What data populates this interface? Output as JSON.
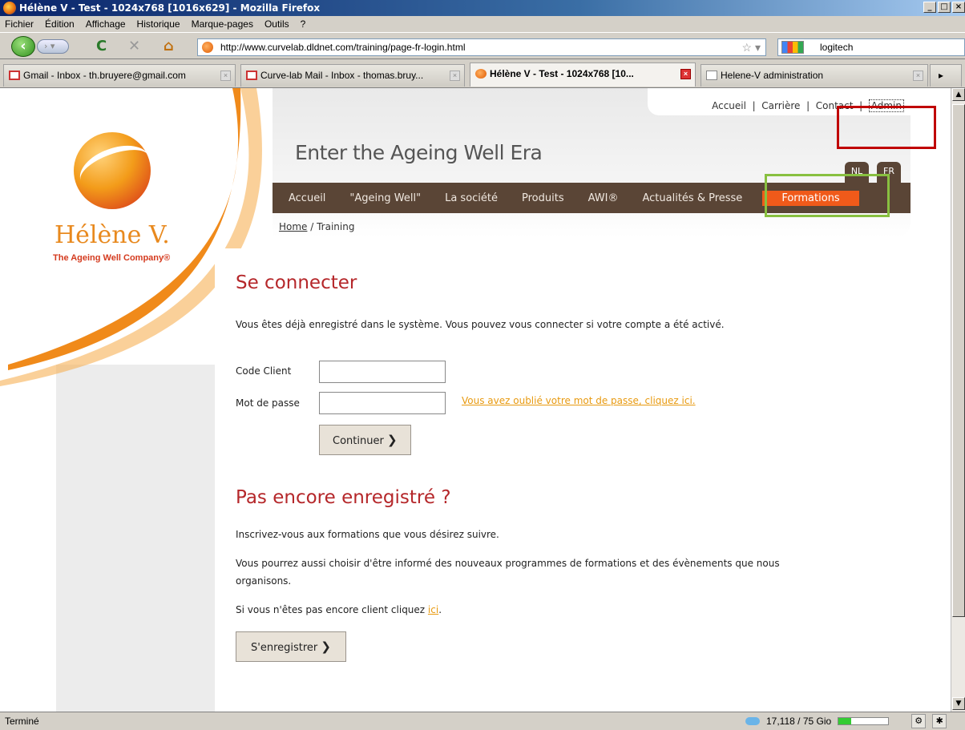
{
  "window": {
    "title": "Hélène V - Test - 1024x768 [1016x629] - Mozilla Firefox",
    "buttons": [
      "_",
      "□",
      "×"
    ]
  },
  "menubar": {
    "items": [
      "Fichier",
      "Édition",
      "Affichage",
      "Historique",
      "Marque-pages",
      "Outils",
      "?"
    ]
  },
  "navbar": {
    "url": "http://www.curvelab.dldnet.com/training/page-fr-login.html",
    "search_value": "logitech",
    "back_icon": "back-arrow-icon",
    "reload_icon": "C",
    "stop_icon": "✕",
    "home_icon": "⌂"
  },
  "tabs": [
    {
      "label": "Gmail - Inbox - th.bruyere@gmail.com",
      "active": false
    },
    {
      "label": "Curve-lab Mail - Inbox - thomas.bruy...",
      "active": false
    },
    {
      "label": "Hélène V - Test - 1024x768 [10...",
      "active": true
    },
    {
      "label": "Helene-V administration",
      "active": false
    }
  ],
  "site": {
    "brand": "Hélène V.",
    "tagline": "The Ageing Well Company®",
    "slogan": "Enter the Ageing Well Era",
    "top_links": [
      "Accueil",
      "Carrière",
      "Contact",
      "Admin"
    ],
    "languages": [
      "NL",
      "FR"
    ],
    "nav": [
      "Accueil",
      "\"Ageing Well\"",
      "La société",
      "Produits",
      "AWI®",
      "Actualités & Presse",
      "Formations"
    ],
    "nav_active": "Formations",
    "breadcrumb": {
      "home": "Home",
      "sep": " / ",
      "current": "Training"
    }
  },
  "login": {
    "heading": "Se connecter",
    "intro": "Vous êtes déjà enregistré dans le système. Vous pouvez vous connecter si votre compte a été activé.",
    "code_label": "Code Client",
    "code_value": "",
    "password_label": "Mot de passe",
    "password_value": "",
    "forgot_link": "Vous avez oublié votre mot de passe, cliquez ici.",
    "submit": "Continuer"
  },
  "register": {
    "heading": "Pas encore enregistré ?",
    "p1": "Inscrivez-vous aux formations que vous désirez suivre.",
    "p2a": "Vous pourrez aussi choisir d'être informé des nouveaux programmes de formations et des évènements que nous",
    "p2b": "organisons.",
    "p3_prefix": "Si vous n'êtes pas encore client cliquez ",
    "p3_link": "ici",
    "p3_suffix": ".",
    "submit": "S'enregistrer"
  },
  "annotations": {
    "red_box_color": "#c00000",
    "green_box_color": "#88c040"
  },
  "status": {
    "text": "Terminé",
    "quota": "17,118 / 75 Gio",
    "quota_fill_percent": 25
  },
  "colors": {
    "accent_orange": "#f05a1a",
    "nav_brown": "#5a4536",
    "heading_red": "#b5272a",
    "link_orange": "#e89a10"
  }
}
